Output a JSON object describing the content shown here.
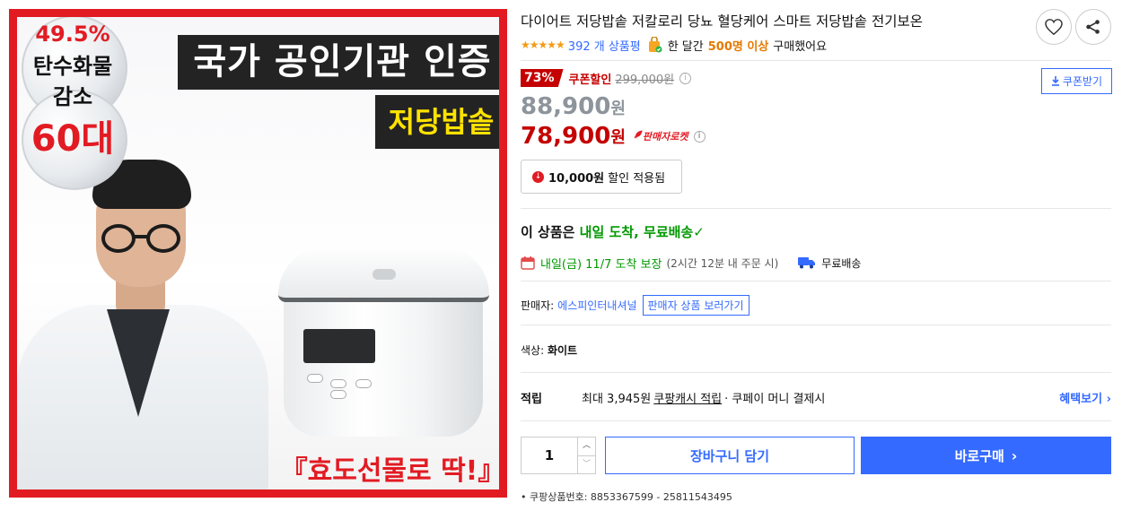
{
  "image": {
    "banner_certified": "국가 공인기관 인증",
    "banner_product": "저당밥솥",
    "badge_percent": "49.5%",
    "badge_line1": "탄수화물",
    "badge_line2": "감소",
    "badge_age": "60대",
    "gift_text": "『효도선물로 딱!』"
  },
  "product": {
    "title": "다이어트 저당밥솥 저칼로리 당뇨 혈당케어 스마트 저당밥솥 전기보온",
    "stars": "★★★★★",
    "review_count": "392 개 상품평",
    "purchase_prefix": "한 달간",
    "purchase_count": "500명 이상",
    "purchase_suffix": "구매했어요"
  },
  "pricing": {
    "discount_rate": "73%",
    "coupon_label": "쿠폰할인",
    "original_price": "299,000원",
    "coupon_button": "쿠폰받기",
    "sale_price": "88,900",
    "coupon_price": "78,900",
    "won": "원",
    "rocket_label": "판매자로켓",
    "applied_amount": "10,000원",
    "applied_text": "할인 적용됨"
  },
  "delivery": {
    "head_prefix": "이 상품은",
    "head_highlight": "내일 도착, 무료배송",
    "check": "✓",
    "arrival": "내일(금) 11/7 도착 보장",
    "order_window": "(2시간 12분 내 주문 시)",
    "free_shipping": "무료배송"
  },
  "seller": {
    "label": "판매자:",
    "name": "에스피인터내셔널",
    "button": "판매자 상품 보러가기"
  },
  "option": {
    "label": "색상:",
    "value": "화이트"
  },
  "points": {
    "label": "적립",
    "prefix": "최대 3,945원",
    "cash": "쿠팡캐시 적립",
    "suffix": "· 쿠페이 머니 결제시",
    "benefit_link": "혜택보기 ›"
  },
  "purchase": {
    "quantity": "1",
    "up": "︿",
    "down": "﹀",
    "cart_button": "장바구니 담기",
    "buy_button": "바로구매",
    "buy_chevron": "›"
  },
  "footer": {
    "product_number": "• 쿠팡상품번호: 8853367599 - 25811543495"
  },
  "colors": {
    "accent_blue": "#346aff",
    "price_red": "#c40000",
    "delivery_green": "#009900",
    "frame_red": "#e21b23"
  },
  "icons": [
    "heart-icon",
    "share-icon",
    "calendar-icon",
    "truck-icon",
    "download-icon",
    "info-icon",
    "rocket-icon",
    "shopping-bag-icon"
  ]
}
